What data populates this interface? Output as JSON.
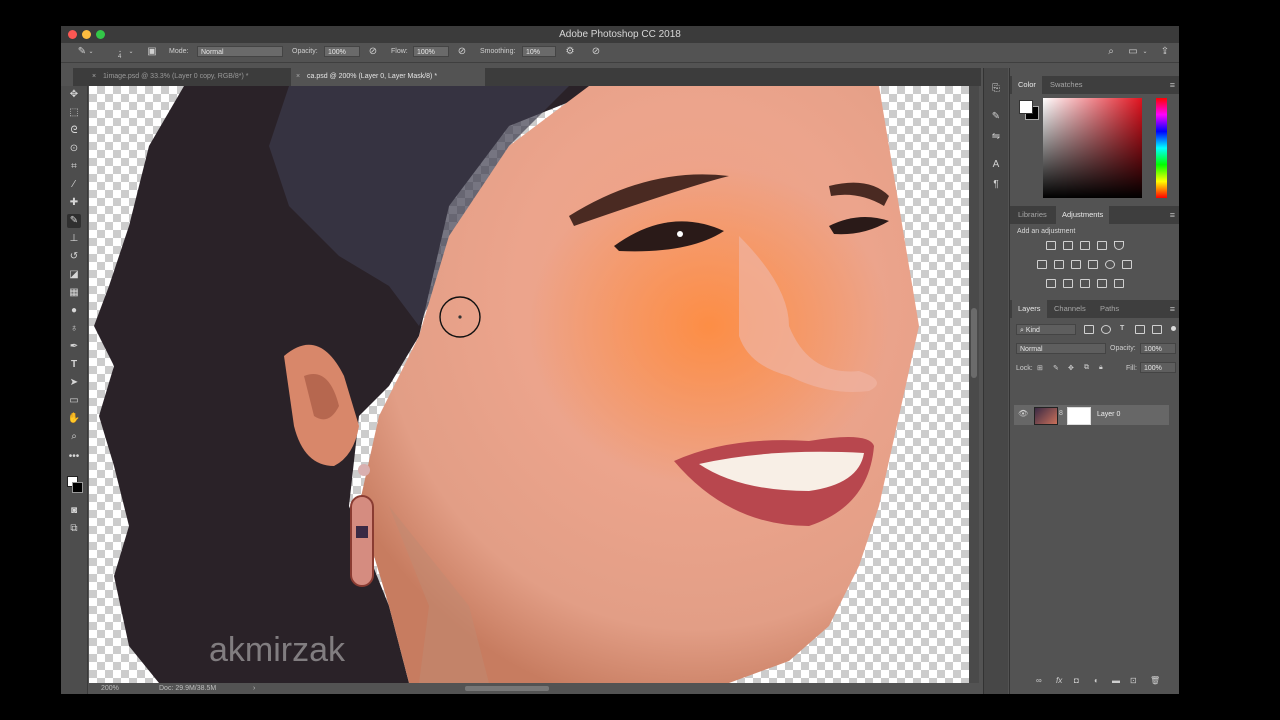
{
  "window": {
    "title": "Adobe Photoshop CC 2018"
  },
  "options": {
    "brush_size": "4",
    "mode_label": "Mode:",
    "mode_value": "Normal",
    "opacity_label": "Opacity:",
    "opacity_value": "100%",
    "flow_label": "Flow:",
    "flow_value": "100%",
    "smoothing_label": "Smoothing:",
    "smoothing_value": "10%"
  },
  "tabs": [
    {
      "label": "1image.psd @ 33.3% (Layer 0 copy, RGB/8*) *",
      "active": false
    },
    {
      "label": "ca.psd @ 200% (Layer 0, Layer Mask/8) *",
      "active": true
    }
  ],
  "canvas": {
    "watermark": "akmirzak"
  },
  "status": {
    "zoom": "200%",
    "doc": "Doc: 29.9M/38.5M"
  },
  "color_panel": {
    "tabs": [
      "Color",
      "Swatches"
    ],
    "fg": "#ffffff",
    "bg": "#000000",
    "hue": "#e1131f"
  },
  "adjustments_panel": {
    "tabs": [
      "Libraries",
      "Adjustments"
    ],
    "hint": "Add an adjustment"
  },
  "layers_panel": {
    "tabs": [
      "Layers",
      "Channels",
      "Paths"
    ],
    "filter_kind": "Kind",
    "blend_mode": "Normal",
    "opacity_label": "Opacity:",
    "opacity_value": "100%",
    "lock_label": "Lock:",
    "fill_label": "Fill:",
    "fill_value": "100%",
    "layers": [
      {
        "name": "Layer 0",
        "visible": true
      }
    ]
  }
}
